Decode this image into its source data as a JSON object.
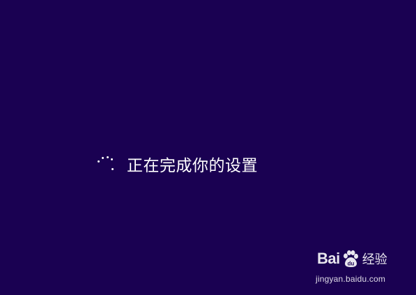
{
  "setup": {
    "status_text": "正在完成你的设置",
    "spinner": "loading-spinner-icon"
  },
  "watermark": {
    "brand_left": "Bai",
    "brand_paw": "du-paw-logo",
    "brand_right": "经验",
    "url": "jingyan.baidu.com"
  },
  "colors": {
    "background": "#1a0152",
    "text": "#ffffff"
  }
}
